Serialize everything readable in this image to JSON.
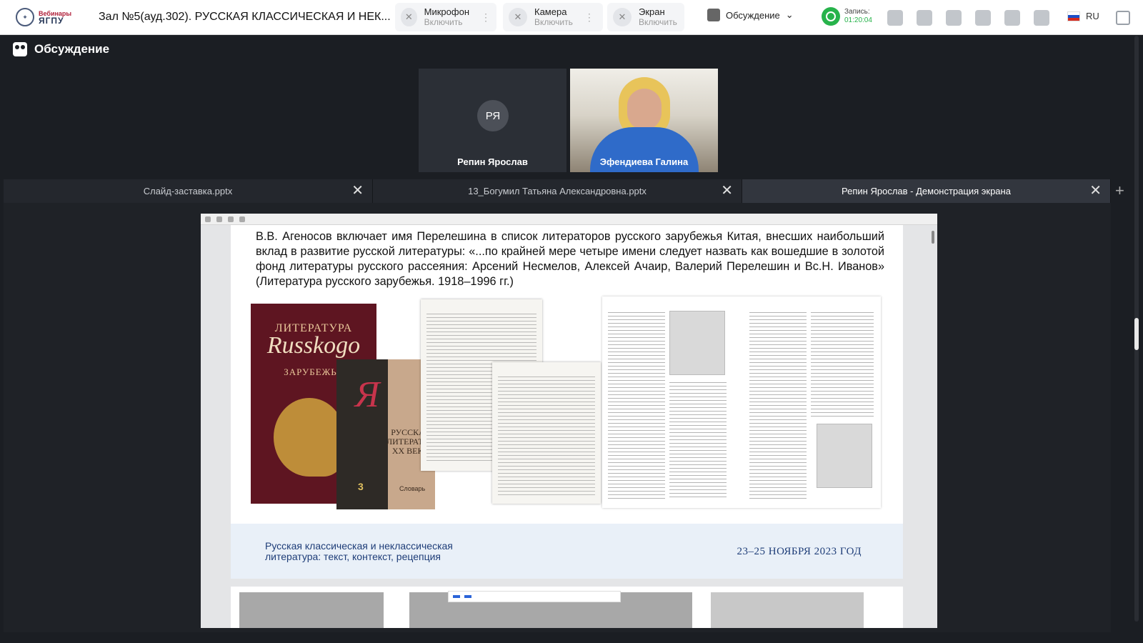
{
  "header": {
    "logo_line1": "Вебинары",
    "logo_line2": "ЯГПУ",
    "room_title": "Зал №5(ауд.302). РУССКАЯ КЛАССИЧЕСКАЯ И НЕК...",
    "mic": {
      "label": "Микрофон",
      "action": "Включить"
    },
    "camera": {
      "label": "Камера",
      "action": "Включить"
    },
    "screen": {
      "label": "Экран",
      "action": "Включить"
    },
    "view_mode": "Обсуждение",
    "record": {
      "label": "Запись:",
      "time": "01:20:04"
    },
    "language": "RU",
    "icons": [
      "grid-icon",
      "whiteboard-icon",
      "folder-icon",
      "participants-icon",
      "info-icon",
      "settings-icon"
    ]
  },
  "discussion": {
    "title": "Обсуждение"
  },
  "participants": [
    {
      "initials": "РЯ",
      "name": "Репин Ярослав",
      "camera": false
    },
    {
      "name": "Эфендиева Галина",
      "camera": true
    }
  ],
  "tabs": [
    {
      "label": "Слайд-заставка.pptx",
      "active": false
    },
    {
      "label": "13_Богумил Татьяна Александровна.pptx",
      "active": false
    },
    {
      "label": "Репин Ярослав - Демонстрация экрана",
      "active": true
    }
  ],
  "slide": {
    "quote": "В.В. Агеносов включает имя Перелешина в список литераторов русского зарубежья Китая, внесших наибольший вклад в развитие русской литературы: «...по крайней мере четыре имени следует назвать как вошедшие в золотой фонд литературы русского рассеяния: Арсений Несмелов, Алексей Ачаир, Валерий Перелешин и Вс.Н. Иванов» (Литература русского зарубежья. 1918–1996 гг.)",
    "book1": {
      "top": "ЛИТЕРАТУРА",
      "script": "Russkogo",
      "bottom": "ЗАРУБЕЖЬЯ"
    },
    "book2": {
      "title": "РУССКАЯ ЛИТЕРАТУРА XX ВЕКА",
      "number": "3",
      "sub": "Словарь"
    },
    "footer_left": "Русская классическая и неклассическая литература: текст, контекст, рецепция",
    "footer_right": "23–25 НОЯБРЯ 2023 ГОД"
  },
  "colors": {
    "record": "#27b34b",
    "brand_blue": "#1e3d78",
    "book_red": "#5e1521"
  }
}
